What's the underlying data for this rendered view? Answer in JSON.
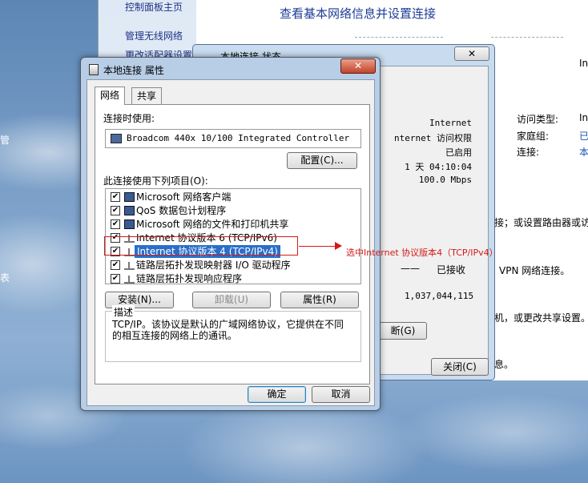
{
  "desktop": {
    "labels": [
      "管",
      "表"
    ]
  },
  "nsc": {
    "sidebar": [
      "控制面板主页",
      "管理无线网络",
      "更改适配器设置"
    ],
    "title": "查看基本网络信息并设置连接",
    "right_cols": [
      "访问类型:",
      "家庭组:",
      "连接:"
    ],
    "right_vals": [
      "Int",
      "已",
      "本"
    ],
    "top_right": "In",
    "snippets": [
      "接；或设置路由器或访",
      "VPN 网络连接。",
      "机，或更改共享设置。",
      "息。"
    ]
  },
  "status": {
    "title": "本地连接 状态",
    "close": "✕",
    "values": [
      "Internet",
      "nternet 访问权限",
      "已启用",
      "1 天 04:10:04",
      "100.0 Mbps"
    ],
    "received_label": "已接收",
    "dash": "——",
    "bytes": "1,037,044,115",
    "diagnose": "断(G)",
    "close_button": "关闭(C)"
  },
  "prop": {
    "title": "本地连接 属性",
    "close": "✕",
    "tabs": [
      "网络",
      "共享"
    ],
    "connect_using": "连接时使用:",
    "adapter": "Broadcom 440x 10/100 Integrated Controller",
    "configure": "配置(C)...",
    "items_label": "此连接使用下列项目(O):",
    "items": [
      {
        "label": "Microsoft 网络客户端",
        "checked": "✔"
      },
      {
        "label": "QoS 数据包计划程序",
        "checked": "✔"
      },
      {
        "label": "Microsoft 网络的文件和打印机共享",
        "checked": "✔"
      },
      {
        "label": "Internet 协议版本 6 (TCP/IPv6)",
        "checked": "✔"
      },
      {
        "label": "Internet 协议版本 4 (TCP/IPv4)",
        "checked": "✔"
      },
      {
        "label": "链路层拓扑发现映射器 I/O 驱动程序",
        "checked": "✔"
      },
      {
        "label": "链路层拓扑发现响应程序",
        "checked": "✔"
      }
    ],
    "install": "安装(N)...",
    "uninstall": "卸载(U)",
    "properties": "属性(R)",
    "desc_label": "描述",
    "desc_text": "TCP/IP。该协议是默认的广域网络协议，它提供在不同的相互连接的网络上的通讯。",
    "ok": "确定",
    "cancel": "取消"
  },
  "annotation": {
    "text": "选中Internet 协议版本4（TCP/IPv4）"
  },
  "colors": {
    "annotation": "#d41a1a",
    "selection": "#2a6ec8",
    "link": "#1e3287"
  }
}
